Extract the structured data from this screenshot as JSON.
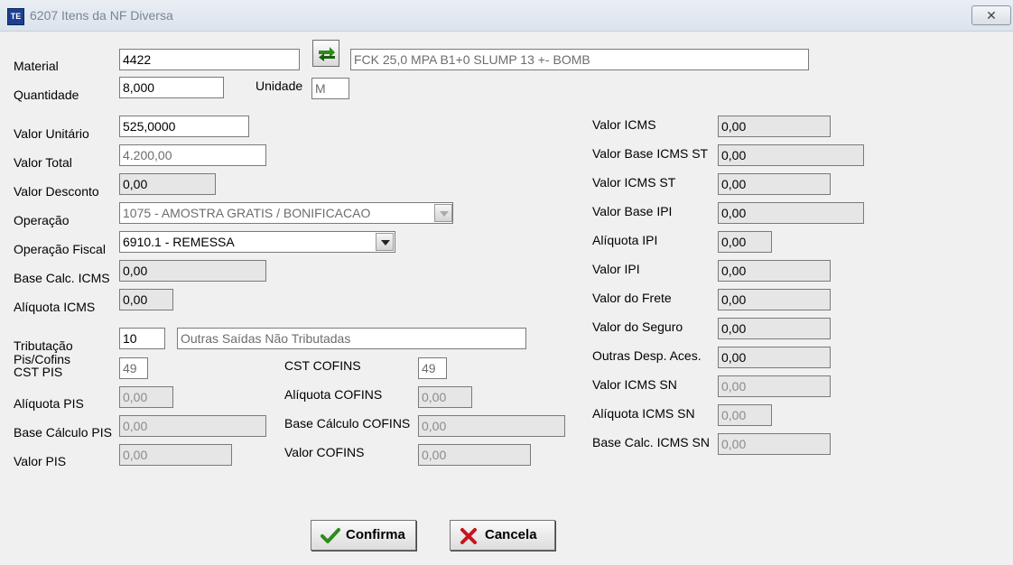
{
  "window": {
    "app_icon": "TE",
    "title": "6207 Itens da NF Diversa",
    "close": "✕"
  },
  "material": {
    "label": "Material",
    "code": "4422",
    "description": "FCK 25,0 MPA B1+0 SLUMP 13 +- BOMB"
  },
  "quantidade": {
    "label": "Quantidade",
    "value": "8,000"
  },
  "unidade": {
    "label": "Unidade",
    "value": "M"
  },
  "valor_unitario": {
    "label": "Valor Unitário",
    "value": "525,0000"
  },
  "valor_total": {
    "label": "Valor Total",
    "value": "4.200,00"
  },
  "valor_desconto": {
    "label": "Valor Desconto",
    "value": "0,00"
  },
  "operacao": {
    "label": "Operação",
    "value": "1075 - AMOSTRA GRATIS / BONIFICACAO"
  },
  "operacao_fiscal": {
    "label": "Operação Fiscal",
    "value": "6910.1 - REMESSA"
  },
  "base_calc_icms": {
    "label": "Base Calc. ICMS",
    "value": "0,00"
  },
  "aliquota_icms": {
    "label": "Alíquota ICMS",
    "value": "0,00"
  },
  "tributacao": {
    "label": "Tributação",
    "code": "10",
    "description": "Outras Saídas Não Tributadas"
  },
  "cst_pis": {
    "label_line1": "Pis/Cofins",
    "label_line2": "CST PIS",
    "value": "49"
  },
  "cst_cofins": {
    "label": "CST COFINS",
    "value": "49"
  },
  "aliquota_pis": {
    "label": "Alíquota PIS",
    "value": "0,00"
  },
  "aliquota_cofins": {
    "label": "Alíquota COFINS",
    "value": "0,00"
  },
  "base_calculo_pis": {
    "label": "Base Cálculo PIS",
    "value": "0,00"
  },
  "base_calculo_cofins": {
    "label": "Base Cálculo COFINS",
    "value": "0,00"
  },
  "valor_pis": {
    "label": "Valor PIS",
    "value": "0,00"
  },
  "valor_cofins": {
    "label": "Valor COFINS",
    "value": "0,00"
  },
  "right": {
    "valor_icms": {
      "label": "Valor ICMS",
      "value": "0,00"
    },
    "valor_base_icms_st": {
      "label": "Valor Base ICMS ST",
      "value": "0,00"
    },
    "valor_icms_st": {
      "label": "Valor ICMS ST",
      "value": "0,00"
    },
    "valor_base_ipi": {
      "label": "Valor Base IPI",
      "value": "0,00"
    },
    "aliquota_ipi": {
      "label": "Alíquota IPI",
      "value": "0,00"
    },
    "valor_ipi": {
      "label": "Valor IPI",
      "value": "0,00"
    },
    "valor_frete": {
      "label": "Valor do Frete",
      "value": "0,00"
    },
    "valor_seguro": {
      "label": "Valor do Seguro",
      "value": "0,00"
    },
    "outras_desp": {
      "label": "Outras Desp. Aces.",
      "value": "0,00"
    },
    "valor_icms_sn": {
      "label": "Valor ICMS SN",
      "value": "0,00"
    },
    "aliquota_icms_sn": {
      "label": "Alíquota ICMS SN",
      "value": "0,00"
    },
    "base_calc_icms_sn": {
      "label": "Base Calc. ICMS SN",
      "value": "0,00"
    }
  },
  "buttons": {
    "confirma": "Confirma",
    "cancela": "Cancela"
  },
  "icons": {
    "lookup": "lookup-arrows-icon",
    "confirm": "checkmark-icon",
    "cancel": "x-mark-icon"
  },
  "colors": {
    "confirm_green": "#2f8a1e",
    "cancel_red": "#c8141e"
  }
}
